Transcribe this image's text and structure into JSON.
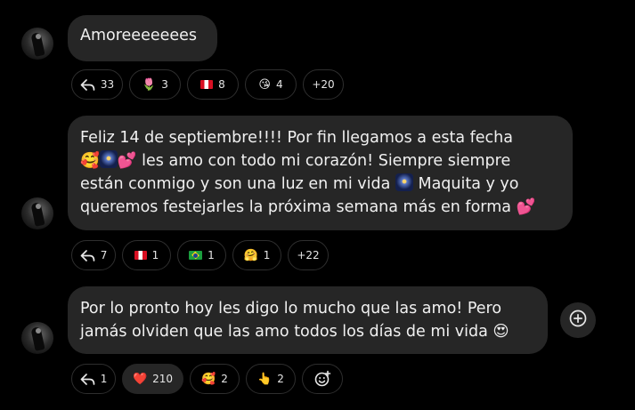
{
  "messages": [
    {
      "text_lines": [
        "Amoreeeeeees"
      ],
      "reactions": {
        "reply_count": "33",
        "items": [
          {
            "emoji": "🌷",
            "count": "3"
          },
          {
            "emoji": "flag-peru",
            "count": "8"
          },
          {
            "emoji": "😘",
            "count": "4"
          }
        ],
        "more": "+20"
      }
    },
    {
      "text_lines": [
        "Feliz 14 de septiembre!!!! Por fin llegamos a esta fecha",
        "🥰🎆💕 les amo con todo mi corazón! Siempre siempre",
        "están conmigo y son una luz en mi vida 🎆 Maquita y yo",
        "queremos festejarles la próxima semana más en forma 💕"
      ],
      "line_parts": {
        "l2_emoji": "🥰",
        "l2_heart": "💕",
        "l2_text": " les amo con todo mi corazón! Siempre siempre",
        "l3_a": "están conmigo y son una luz en mi vida ",
        "l3_b": " Maquita y yo",
        "l4_text": "queremos festejarles la próxima semana más en forma ",
        "l4_heart": "💕"
      },
      "reactions": {
        "reply_count": "7",
        "items": [
          {
            "emoji": "flag-peru",
            "count": "1"
          },
          {
            "emoji": "flag-brazil",
            "count": "1"
          },
          {
            "emoji": "🤗",
            "count": "1"
          }
        ],
        "more": "+22"
      }
    },
    {
      "text_lines": [
        "Por lo pronto hoy les digo lo mucho que las amo! Pero",
        "jamás olviden que las amo todos los días de mi vida 😍"
      ],
      "reactions": {
        "reply_count": "1",
        "items": [
          {
            "emoji": "❤️",
            "count": "210",
            "selected": true
          },
          {
            "emoji": "🥰",
            "count": "2"
          },
          {
            "emoji": "👆",
            "count": "2"
          }
        ],
        "add_reaction_icon": "add-reaction-icon"
      }
    }
  ],
  "icons": {
    "reply": "reply-arrow-icon",
    "add_message": "add-circle-icon",
    "avatar": "user-avatar"
  },
  "colors": {
    "background": "#000000",
    "bubble": "#262626",
    "chip_border": "#2e2e2e",
    "text": "#f0f0f0"
  }
}
